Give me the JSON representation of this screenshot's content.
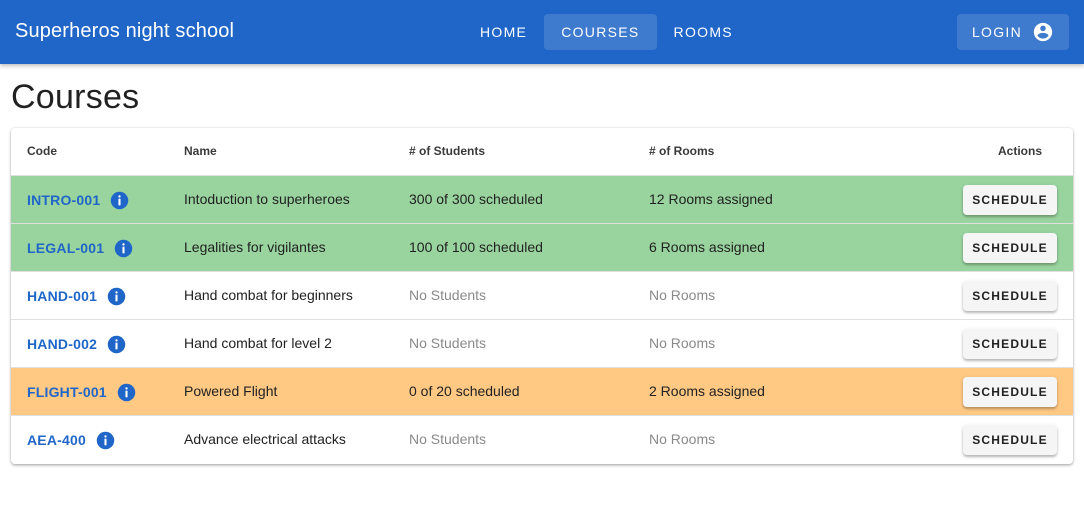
{
  "app": {
    "title": "Superheros night school",
    "accent_color": "#1f66c8"
  },
  "nav": {
    "items": [
      {
        "label": "HOME",
        "active": false
      },
      {
        "label": "COURSES",
        "active": true
      },
      {
        "label": "ROOMS",
        "active": false
      }
    ],
    "login_label": "LOGIN",
    "login_icon": "account-circle-icon"
  },
  "page": {
    "title": "Courses"
  },
  "table": {
    "columns": {
      "code": "Code",
      "name": "Name",
      "students": "# of Students",
      "rooms": "# of Rooms",
      "actions": "Actions"
    },
    "status_colors": {
      "full": "#99d49e",
      "partial": "#ffc984",
      "none": "#ffffff"
    },
    "rows": [
      {
        "code": "INTRO-001",
        "name": "Intoduction to superheroes",
        "students": "300 of 300 scheduled",
        "rooms": "12 Rooms assigned",
        "action": "SCHEDULE",
        "status": "full"
      },
      {
        "code": "LEGAL-001",
        "name": "Legalities for vigilantes",
        "students": "100 of 100 scheduled",
        "rooms": "6 Rooms assigned",
        "action": "SCHEDULE",
        "status": "full"
      },
      {
        "code": "HAND-001",
        "name": "Hand combat for beginners",
        "students": "No Students",
        "rooms": "No Rooms",
        "action": "SCHEDULE",
        "status": "none"
      },
      {
        "code": "HAND-002",
        "name": "Hand combat for level 2",
        "students": "No Students",
        "rooms": "No Rooms",
        "action": "SCHEDULE",
        "status": "none"
      },
      {
        "code": "FLIGHT-001",
        "name": "Powered Flight",
        "students": "0 of 20 scheduled",
        "rooms": "2 Rooms assigned",
        "action": "SCHEDULE",
        "status": "partial"
      },
      {
        "code": "AEA-400",
        "name": "Advance electrical attacks",
        "students": "No Students",
        "rooms": "No Rooms",
        "action": "SCHEDULE",
        "status": "none"
      }
    ]
  }
}
